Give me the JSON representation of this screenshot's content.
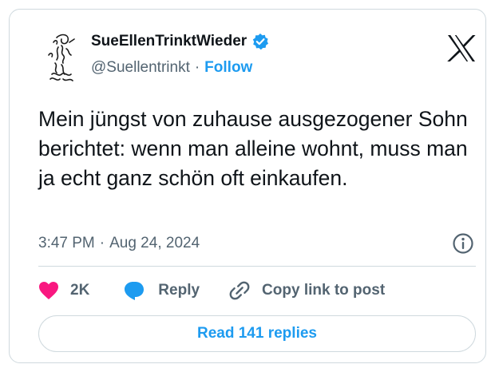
{
  "author": {
    "display_name": "SueEllenTrinktWieder",
    "handle": "@Suellentrinkt",
    "separator": "·",
    "follow_label": "Follow",
    "verified_icon": "verified-badge-icon",
    "avatar": "sketch-drawing-avatar"
  },
  "brand": {
    "logo_icon": "x-logo-icon"
  },
  "tweet": {
    "text": "Mein jüngst von zuhause ausgezogener Sohn berichtet: wenn man alleine wohnt, muss man ja echt ganz schön oft einkaufen.",
    "time": "3:47 PM",
    "separator": "·",
    "date": "Aug 24, 2024",
    "info_icon": "info-icon"
  },
  "actions": {
    "like_count": "2K",
    "reply_label": "Reply",
    "copy_label": "Copy link to post",
    "like_icon": "heart-icon",
    "reply_icon": "speech-bubble-icon",
    "copy_icon": "link-icon"
  },
  "footer": {
    "read_replies_label": "Read 141 replies"
  },
  "colors": {
    "accent": "#1d9bf0",
    "like": "#f91880",
    "text_primary": "#0f1419",
    "text_secondary": "#536471",
    "border": "#cfd9de"
  }
}
